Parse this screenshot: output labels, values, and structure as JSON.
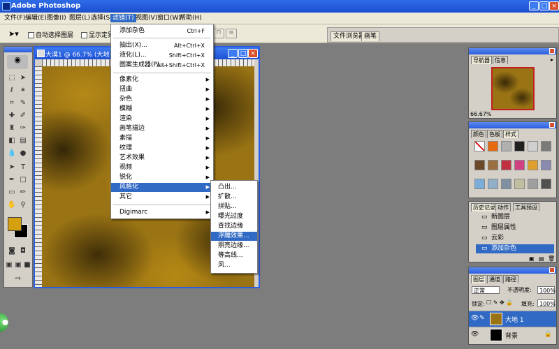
{
  "app": {
    "title": "Adobe Photoshop"
  },
  "window_controls": {
    "minimize": "_",
    "maximize": "□",
    "close": "×"
  },
  "menubar": [
    "文件(F)",
    "编辑(E)",
    "图像(I)",
    "图层(L)",
    "选择(S)",
    "滤镜(T)",
    "视图(V)",
    "窗口(W)",
    "帮助(H)"
  ],
  "optbar": {
    "auto_select": "自动选择图层",
    "show_bounds": "显示定界框",
    "palette_tabs": [
      "文件浏览器",
      "画笔"
    ]
  },
  "document": {
    "title": "大漠1 @ 66.7% (大地 1..."
  },
  "filter_menu": {
    "top": [
      {
        "label": "添加杂色",
        "shortcut": "Ctrl+F"
      },
      {
        "label": "抽出(X)...",
        "shortcut": "Alt+Ctrl+X"
      },
      {
        "label": "液化(L)...",
        "shortcut": "Shift+Ctrl+X"
      },
      {
        "label": "图案生成器(P)...",
        "shortcut": "Alt+Shift+Ctrl+X"
      }
    ],
    "sub": [
      "像素化",
      "扭曲",
      "杂色",
      "模糊",
      "渲染",
      "画笔描边",
      "素描",
      "纹理",
      "艺术效果",
      "视频",
      "锐化",
      "风格化",
      "其它"
    ],
    "highlighted": "风格化",
    "bottom": "Digimarc"
  },
  "stylize_menu": {
    "items": [
      "凸出...",
      "扩散...",
      "拼贴...",
      "曝光过度",
      "查找边缘",
      "浮雕效果...",
      "照亮边缘...",
      "等高线...",
      "风..."
    ],
    "highlighted": "浮雕效果..."
  },
  "navigator": {
    "tabs": [
      "导航器",
      "信息"
    ],
    "zoom": "66.67%"
  },
  "styles": {
    "tabs": [
      "颜色",
      "色板",
      "样式"
    ],
    "swatches": [
      "#ffffff",
      "#e86a10",
      "#b0b0b0",
      "#202020",
      "#d0d0d0",
      "#7a7a7a",
      "#6b4a2a",
      "#9a7040",
      "#c03040",
      "#d04080",
      "#e0a030",
      "#8a8ab0",
      "#7aaed8",
      "#90b0c8",
      "#8090a0",
      "#c0c0a0",
      "#a0a0a0",
      "#505050"
    ]
  },
  "history": {
    "tabs": [
      "历史记录",
      "动作",
      "工具预设"
    ],
    "items": [
      "新图层",
      "图层属性",
      "云彩",
      "添加杂色"
    ],
    "highlighted": "添加杂色"
  },
  "layers": {
    "tabs": [
      "图层",
      "通道",
      "路径"
    ],
    "blend_mode": "正常",
    "opacity_label": "不透明度:",
    "opacity": "100%",
    "lock_label": "锁定:",
    "fill_label": "填充:",
    "fill": "100%",
    "items": [
      {
        "name": "大地 1",
        "selected": true
      },
      {
        "name": "背景",
        "selected": false
      }
    ]
  },
  "colors": {
    "foreground": "#d4a010",
    "background": "#000000",
    "accent": "#316ac5"
  }
}
